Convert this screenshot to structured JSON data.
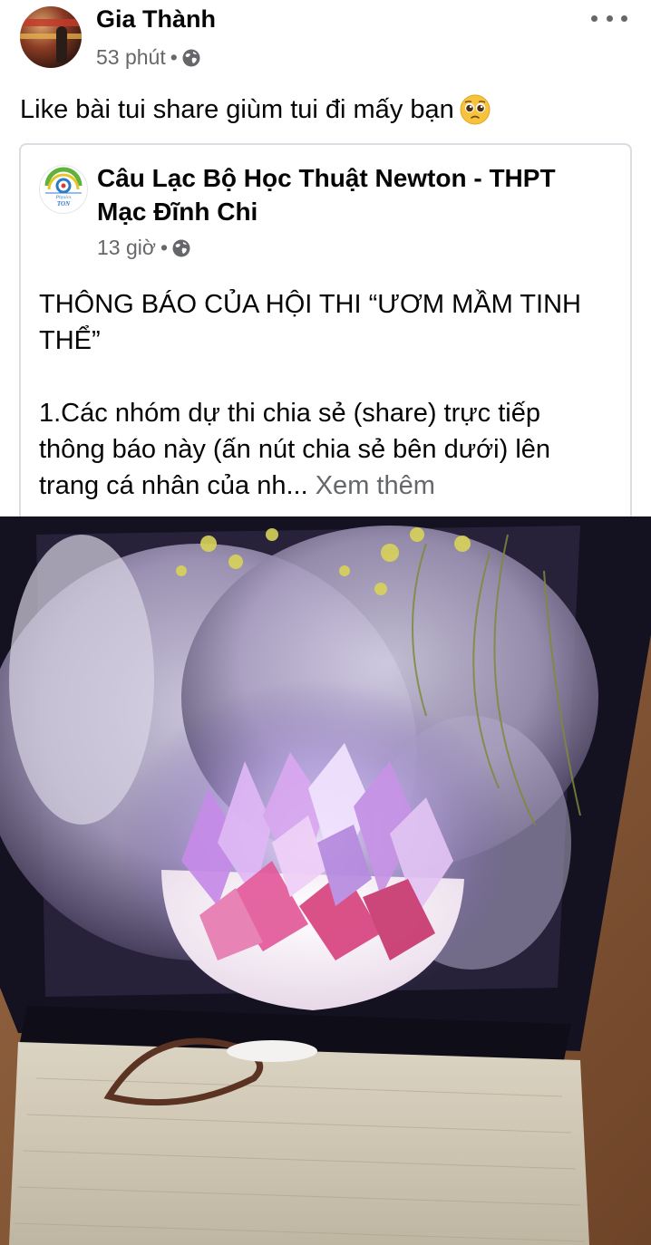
{
  "post": {
    "author_name": "Gia Thành",
    "time": "53 phút",
    "separator": "•",
    "privacy_icon": "globe-icon",
    "text": "Like bài tui share giùm tui đi mấy bạn",
    "emoji": "pleading-face-emoji",
    "more_icon": "more-options-icon"
  },
  "shared_post": {
    "page_name": "Câu Lạc Bộ Học Thuật Newton - THPT Mạc Đĩnh Chi",
    "time": "13 giờ",
    "separator": "•",
    "privacy_icon": "globe-icon",
    "logo_text": "Physics TON",
    "title": "THÔNG BÁO CỦA HỘI THI “ƯƠM MẦM TINH THỂ”",
    "body": "1.Các nhóm dự thi chia sẻ (share) trực tiếp thông báo này (ấn nút chia sẻ bên dưới) lên trang cá nhân của nh...",
    "see_more": "Xem thêm"
  },
  "photo": {
    "subject": "pink crystal cluster in a box"
  },
  "colors": {
    "text_primary": "#050505",
    "text_secondary": "#65676b",
    "card_border": "#dadde1"
  }
}
